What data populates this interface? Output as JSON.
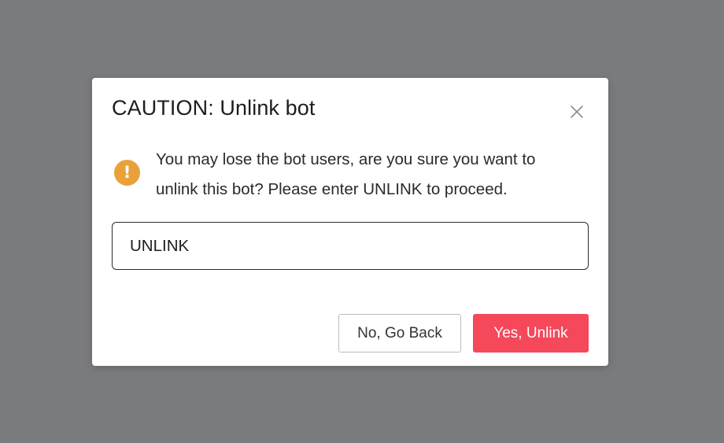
{
  "dialog": {
    "title": "CAUTION: Unlink bot",
    "close_icon": "close-icon",
    "warning_icon": "exclamation-circle-icon",
    "message": "You may lose the bot users, are you sure you want to unlink this bot? Please enter UNLINK to proceed.",
    "input_value": "UNLINK",
    "cancel_label": "No, Go Back",
    "confirm_label": "Yes, Unlink"
  },
  "colors": {
    "backdrop": "#7a7b7d",
    "warning": "#e9a23b",
    "confirm": "#f5485b"
  }
}
